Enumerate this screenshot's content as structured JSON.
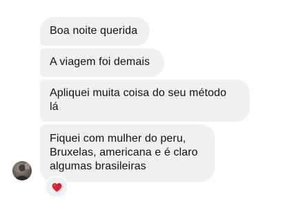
{
  "conversation": {
    "messages": [
      {
        "text": "Boa noite querida"
      },
      {
        "text": "A viagem foi demais"
      },
      {
        "text": "Apliquei muita coisa do seu método\nlá"
      },
      {
        "text": "Fiquei com mulher do peru,\nBruxelas, americana e é claro\nalgumas brasileiras"
      }
    ],
    "last_message_reaction": {
      "icon": "red-heart-icon",
      "color": "#e0202e"
    },
    "sender_avatar": {
      "icon": "profile-photo"
    },
    "colors": {
      "bubble_background": "#f0f0f0",
      "text": "#111111",
      "page_background": "#ffffff"
    }
  }
}
